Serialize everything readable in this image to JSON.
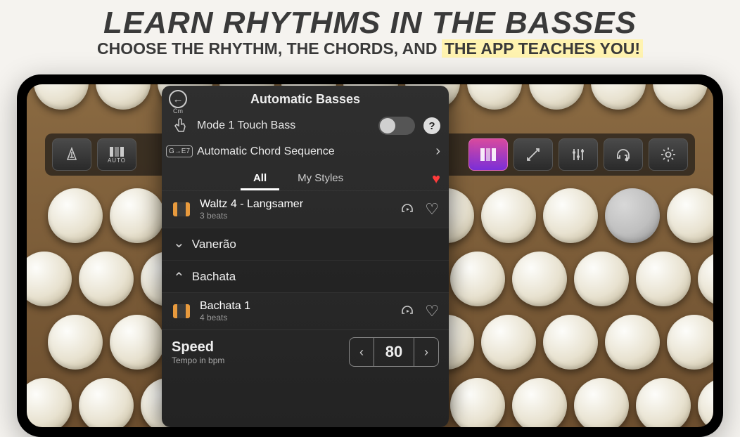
{
  "promo": {
    "title": "LEARN RHYTHMS IN THE BASSES",
    "subtitle_pre": "CHOOSE THE RHYTHM, THE CHORDS, AND ",
    "subtitle_hl": "THE APP TEACHES YOU!"
  },
  "panel": {
    "title": "Automatic Basses",
    "back_sub": "Cm",
    "mode_label": "Mode 1 Touch Bass",
    "seq_label": "Automatic Chord Sequence",
    "seq_icon_text": "G→E7",
    "tabs": {
      "all": "All",
      "my": "My Styles"
    },
    "items": {
      "waltz": {
        "name": "Waltz 4 - Langsamer",
        "meta": "3 beats"
      },
      "vanerao": {
        "name": "Vanerão"
      },
      "bachata_group": {
        "name": "Bachata"
      },
      "bachata1": {
        "name": "Bachata 1",
        "meta": "4 beats"
      }
    },
    "speed": {
      "title": "Speed",
      "sub": "Tempo in bpm",
      "value": "80"
    }
  },
  "toolbar": {
    "auto_label": "AUTO"
  }
}
